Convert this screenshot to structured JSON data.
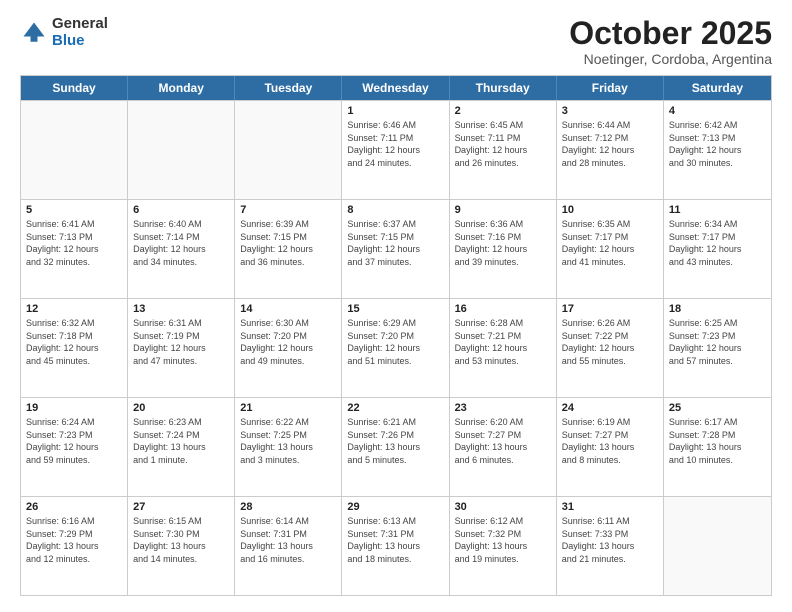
{
  "logo": {
    "general": "General",
    "blue": "Blue"
  },
  "title": "October 2025",
  "subtitle": "Noetinger, Cordoba, Argentina",
  "weekdays": [
    "Sunday",
    "Monday",
    "Tuesday",
    "Wednesday",
    "Thursday",
    "Friday",
    "Saturday"
  ],
  "rows": [
    [
      {
        "day": "",
        "info": ""
      },
      {
        "day": "",
        "info": ""
      },
      {
        "day": "",
        "info": ""
      },
      {
        "day": "1",
        "info": "Sunrise: 6:46 AM\nSunset: 7:11 PM\nDaylight: 12 hours\nand 24 minutes."
      },
      {
        "day": "2",
        "info": "Sunrise: 6:45 AM\nSunset: 7:11 PM\nDaylight: 12 hours\nand 26 minutes."
      },
      {
        "day": "3",
        "info": "Sunrise: 6:44 AM\nSunset: 7:12 PM\nDaylight: 12 hours\nand 28 minutes."
      },
      {
        "day": "4",
        "info": "Sunrise: 6:42 AM\nSunset: 7:13 PM\nDaylight: 12 hours\nand 30 minutes."
      }
    ],
    [
      {
        "day": "5",
        "info": "Sunrise: 6:41 AM\nSunset: 7:13 PM\nDaylight: 12 hours\nand 32 minutes."
      },
      {
        "day": "6",
        "info": "Sunrise: 6:40 AM\nSunset: 7:14 PM\nDaylight: 12 hours\nand 34 minutes."
      },
      {
        "day": "7",
        "info": "Sunrise: 6:39 AM\nSunset: 7:15 PM\nDaylight: 12 hours\nand 36 minutes."
      },
      {
        "day": "8",
        "info": "Sunrise: 6:37 AM\nSunset: 7:15 PM\nDaylight: 12 hours\nand 37 minutes."
      },
      {
        "day": "9",
        "info": "Sunrise: 6:36 AM\nSunset: 7:16 PM\nDaylight: 12 hours\nand 39 minutes."
      },
      {
        "day": "10",
        "info": "Sunrise: 6:35 AM\nSunset: 7:17 PM\nDaylight: 12 hours\nand 41 minutes."
      },
      {
        "day": "11",
        "info": "Sunrise: 6:34 AM\nSunset: 7:17 PM\nDaylight: 12 hours\nand 43 minutes."
      }
    ],
    [
      {
        "day": "12",
        "info": "Sunrise: 6:32 AM\nSunset: 7:18 PM\nDaylight: 12 hours\nand 45 minutes."
      },
      {
        "day": "13",
        "info": "Sunrise: 6:31 AM\nSunset: 7:19 PM\nDaylight: 12 hours\nand 47 minutes."
      },
      {
        "day": "14",
        "info": "Sunrise: 6:30 AM\nSunset: 7:20 PM\nDaylight: 12 hours\nand 49 minutes."
      },
      {
        "day": "15",
        "info": "Sunrise: 6:29 AM\nSunset: 7:20 PM\nDaylight: 12 hours\nand 51 minutes."
      },
      {
        "day": "16",
        "info": "Sunrise: 6:28 AM\nSunset: 7:21 PM\nDaylight: 12 hours\nand 53 minutes."
      },
      {
        "day": "17",
        "info": "Sunrise: 6:26 AM\nSunset: 7:22 PM\nDaylight: 12 hours\nand 55 minutes."
      },
      {
        "day": "18",
        "info": "Sunrise: 6:25 AM\nSunset: 7:23 PM\nDaylight: 12 hours\nand 57 minutes."
      }
    ],
    [
      {
        "day": "19",
        "info": "Sunrise: 6:24 AM\nSunset: 7:23 PM\nDaylight: 12 hours\nand 59 minutes."
      },
      {
        "day": "20",
        "info": "Sunrise: 6:23 AM\nSunset: 7:24 PM\nDaylight: 13 hours\nand 1 minute."
      },
      {
        "day": "21",
        "info": "Sunrise: 6:22 AM\nSunset: 7:25 PM\nDaylight: 13 hours\nand 3 minutes."
      },
      {
        "day": "22",
        "info": "Sunrise: 6:21 AM\nSunset: 7:26 PM\nDaylight: 13 hours\nand 5 minutes."
      },
      {
        "day": "23",
        "info": "Sunrise: 6:20 AM\nSunset: 7:27 PM\nDaylight: 13 hours\nand 6 minutes."
      },
      {
        "day": "24",
        "info": "Sunrise: 6:19 AM\nSunset: 7:27 PM\nDaylight: 13 hours\nand 8 minutes."
      },
      {
        "day": "25",
        "info": "Sunrise: 6:17 AM\nSunset: 7:28 PM\nDaylight: 13 hours\nand 10 minutes."
      }
    ],
    [
      {
        "day": "26",
        "info": "Sunrise: 6:16 AM\nSunset: 7:29 PM\nDaylight: 13 hours\nand 12 minutes."
      },
      {
        "day": "27",
        "info": "Sunrise: 6:15 AM\nSunset: 7:30 PM\nDaylight: 13 hours\nand 14 minutes."
      },
      {
        "day": "28",
        "info": "Sunrise: 6:14 AM\nSunset: 7:31 PM\nDaylight: 13 hours\nand 16 minutes."
      },
      {
        "day": "29",
        "info": "Sunrise: 6:13 AM\nSunset: 7:31 PM\nDaylight: 13 hours\nand 18 minutes."
      },
      {
        "day": "30",
        "info": "Sunrise: 6:12 AM\nSunset: 7:32 PM\nDaylight: 13 hours\nand 19 minutes."
      },
      {
        "day": "31",
        "info": "Sunrise: 6:11 AM\nSunset: 7:33 PM\nDaylight: 13 hours\nand 21 minutes."
      },
      {
        "day": "",
        "info": ""
      }
    ]
  ]
}
